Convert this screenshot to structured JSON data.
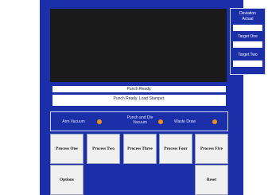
{
  "side_panel": {
    "labels": {
      "deviation": "Deviation",
      "actual": "Actual",
      "target_one": "Target One",
      "target_two": "Target Two"
    },
    "values": {
      "actual": "",
      "target_one": "",
      "target_two": ""
    }
  },
  "status": {
    "line1": "Punch Ready.",
    "line2": "Punch Ready. Load Stamper."
  },
  "indicators": [
    {
      "label": "Arm Vacuum",
      "color": "#f28c1a"
    },
    {
      "label": "Punch and Die Vacuum",
      "color": "#f28c1a"
    },
    {
      "label": "Waste Draw",
      "color": "#f28c1a"
    }
  ],
  "buttons": {
    "process_one": "Process One",
    "process_two": "Process Two",
    "process_three": "Process Three",
    "process_four": "Process Four",
    "process_five": "Process Five",
    "options": "Options",
    "reset": "Reset"
  },
  "colors": {
    "panel": "#1a2fa8",
    "screen": "#1a1a1a",
    "indicator_on": "#f28c1a",
    "button": "#f0f0f0"
  }
}
